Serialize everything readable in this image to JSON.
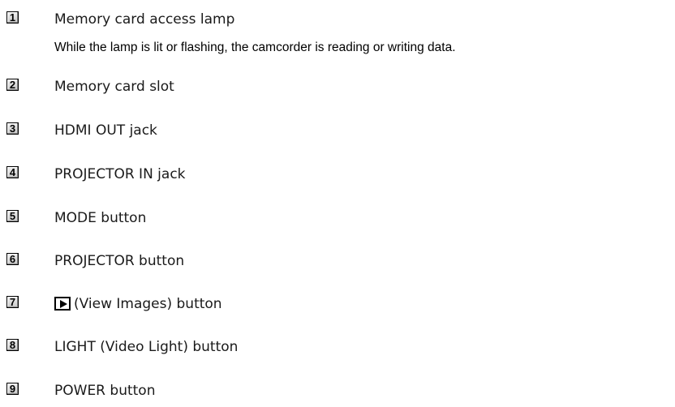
{
  "items": [
    {
      "number": "1",
      "label": "Memory card access lamp",
      "description": "While the lamp is lit or flashing, the camcorder is reading or writing data."
    },
    {
      "number": "2",
      "label": "Memory card slot"
    },
    {
      "number": "3",
      "label": "HDMI OUT jack"
    },
    {
      "number": "4",
      "label": "PROJECTOR IN jack"
    },
    {
      "number": "5",
      "label": "MODE button"
    },
    {
      "number": "6",
      "label": "PROJECTOR button"
    },
    {
      "number": "7",
      "label": "(View Images) button",
      "icon": "play-icon"
    },
    {
      "number": "8",
      "label": "LIGHT (Video Light) button"
    },
    {
      "number": "9",
      "label": "POWER button"
    }
  ]
}
